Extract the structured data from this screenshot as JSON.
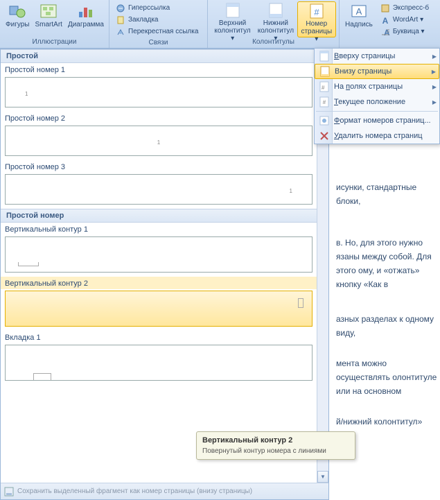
{
  "ribbon": {
    "groups": {
      "illustrations": {
        "label": "Иллюстрации",
        "shapes": "Фигуры",
        "smartart": "SmartArt",
        "chart": "Диаграмма"
      },
      "links": {
        "label": "Связи",
        "hyperlink": "Гиперссылка",
        "bookmark": "Закладка",
        "crossref": "Перекрестная ссылка"
      },
      "headers": {
        "label": "Колонтитулы",
        "header": "Верхний колонтитул",
        "footer": "Нижний колонтитул",
        "pagenum": "Номер страницы"
      },
      "text": {
        "textbox": "Надпись",
        "quickparts": "Экспресс-б",
        "wordart": "WordArt",
        "dropcap": "Буквица"
      }
    }
  },
  "submenu": {
    "top": "Вверху страницы",
    "bottom": "Внизу страницы",
    "margins": "На полях страницы",
    "current": "Текущее положение",
    "format": "Формат номеров страниц...",
    "remove": "Удалить номера страниц"
  },
  "gallery": {
    "cat_simple": "Простой",
    "items_simple": [
      "Простой номер 1",
      "Простой номер 2",
      "Простой номер 3"
    ],
    "cat_simple_num": "Простой номер",
    "items_contour": [
      "Вертикальный контур 1",
      "Вертикальный контур 2"
    ],
    "item_tab": "Вкладка 1",
    "footer": "Сохранить выделенный фрагмент как номер страницы (внизу страницы)"
  },
  "tooltip": {
    "title": "Вертикальный контур 2",
    "desc": "Повернутый контур номера с линиями"
  },
  "doc": {
    "p1": "исунки, стандартные блоки,",
    "p2": "в. Но, для этого нужно язаны между собой. Для этого ому, и «отжать» кнопку «Как в",
    "p3": "азных разделах к одному виду,",
    "p4": "мента можно осуществлять олонтитуле или на основном",
    "p5": "й/нижний колонтитул»"
  }
}
